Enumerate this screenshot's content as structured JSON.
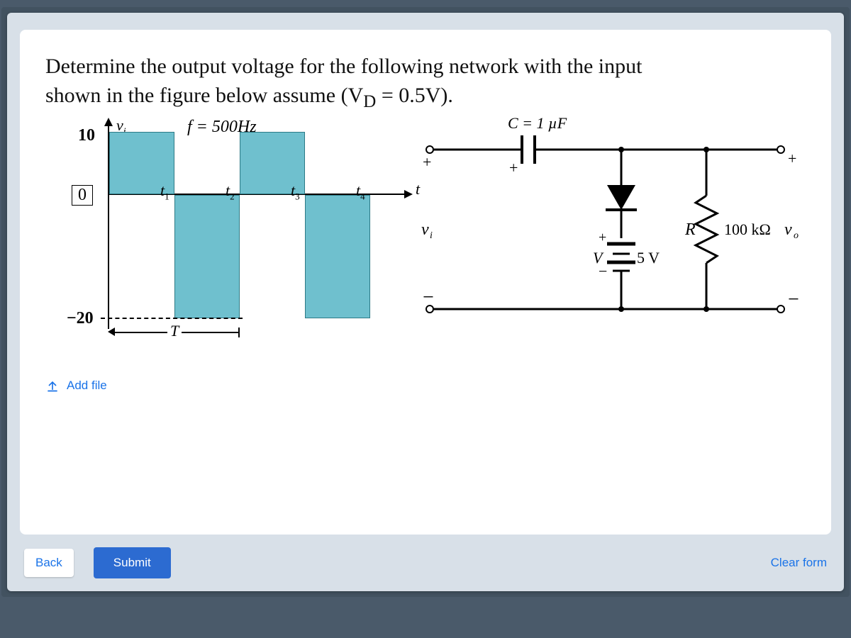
{
  "question": {
    "line1": "Determine the output voltage for the following network with the input",
    "line2": "shown in the figure below assume (V",
    "line2_sub": "D",
    "line2_after": " = 0.5V)."
  },
  "waveform": {
    "vi_label": "v",
    "vi_sub": "i",
    "frequency": "f = 500Hz",
    "y_top": "10",
    "y_zero": "0",
    "y_bottom": "−20",
    "ticks": {
      "t1": "t",
      "t1s": "1",
      "t2": "t",
      "t2s": "2",
      "t3": "t",
      "t3s": "3",
      "t4": "t",
      "t4s": "4"
    },
    "period_label": "T",
    "t_axis": "t"
  },
  "circuit": {
    "cap_label": "C = 1 µF",
    "cap_plus": "+",
    "vi": "v",
    "vi_sub": "i",
    "R_label": "R",
    "R_value": "100 kΩ",
    "vo": "v",
    "vo_sub": "o",
    "V_label": "V",
    "V_value": "5 V",
    "plus_top_l": "+",
    "plus_top_r": "+",
    "minus_l": "−",
    "minus_r": "−",
    "diode_plus": "+",
    "diode_minus": "−"
  },
  "controls": {
    "add_file": "Add file",
    "back": "Back",
    "submit": "Submit",
    "clear": "Clear form"
  },
  "chart_data": {
    "type": "bar",
    "title": "Input square wave vi",
    "xlabel": "t",
    "ylabel": "vi",
    "ylim": [
      -20,
      10
    ],
    "categories": [
      "0–t1",
      "t1–t2",
      "t2–t3",
      "t3–t4"
    ],
    "values": [
      10,
      -20,
      10,
      -20
    ],
    "frequency_hz": 500,
    "period_span": "0 to t2"
  }
}
